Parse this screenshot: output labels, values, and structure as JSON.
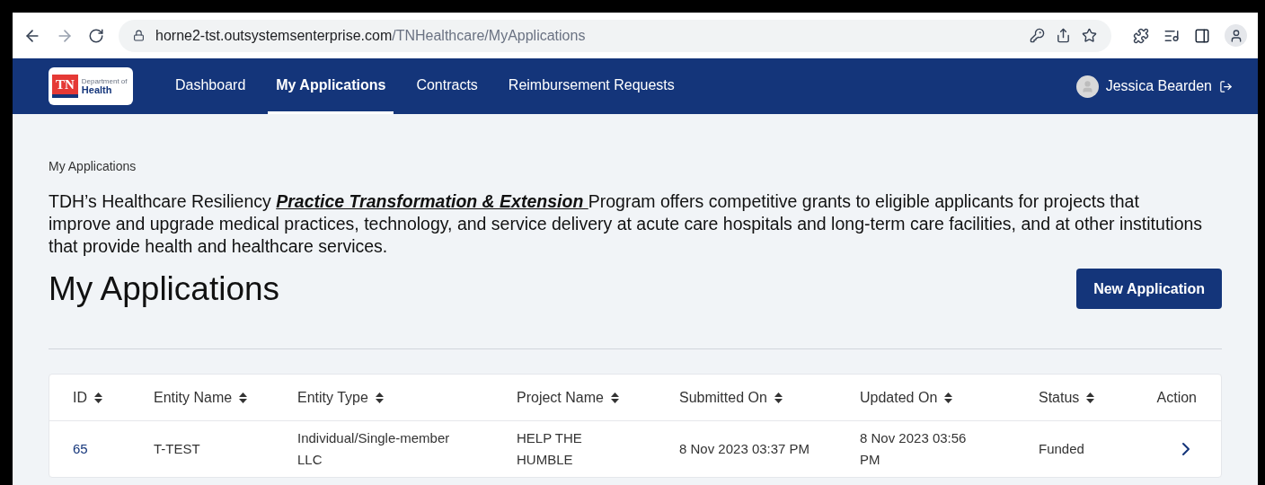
{
  "browser": {
    "url_host": "horne2-tst.outsystemsenterprise.com",
    "url_path": "/TNHealthcare/MyApplications"
  },
  "logo": {
    "badge": "TN",
    "line1": "Department of",
    "line2": "Health"
  },
  "nav": [
    {
      "label": "Dashboard",
      "selected": false
    },
    {
      "label": "My Applications",
      "selected": true
    },
    {
      "label": "Contracts",
      "selected": false
    },
    {
      "label": "Reimbursement Requests",
      "selected": false
    }
  ],
  "user": {
    "name": "Jessica Bearden"
  },
  "breadcrumb": "My Applications",
  "description": {
    "before": "TDH’s Healthcare Resiliency ",
    "link": "Practice Transformation & Extension ",
    "after": "Program offers competitive grants to eligible applicants for projects that improve and upgrade medical practices, technology, and service delivery at acute care hospitals and long-term care facilities, and at other institutions that provide health and healthcare services."
  },
  "title": "My Applications",
  "new_button": "New Application",
  "table": {
    "columns": [
      {
        "label": "ID",
        "sortable": true
      },
      {
        "label": "Entity Name",
        "sortable": true
      },
      {
        "label": "Entity Type",
        "sortable": true
      },
      {
        "label": "Project Name",
        "sortable": true
      },
      {
        "label": "Submitted On",
        "sortable": true
      },
      {
        "label": "Updated On",
        "sortable": true
      },
      {
        "label": "Status",
        "sortable": true
      },
      {
        "label": "Action",
        "sortable": false
      }
    ],
    "rows": [
      {
        "id": "65",
        "entity_name": "T-TEST",
        "entity_type": "Individual/Single-member LLC",
        "project_name": "HELP THE HUMBLE",
        "submitted_on": "8 Nov 2023 03:37 PM",
        "updated_on": "8 Nov 2023 03:56 PM",
        "status": "Funded"
      }
    ]
  }
}
